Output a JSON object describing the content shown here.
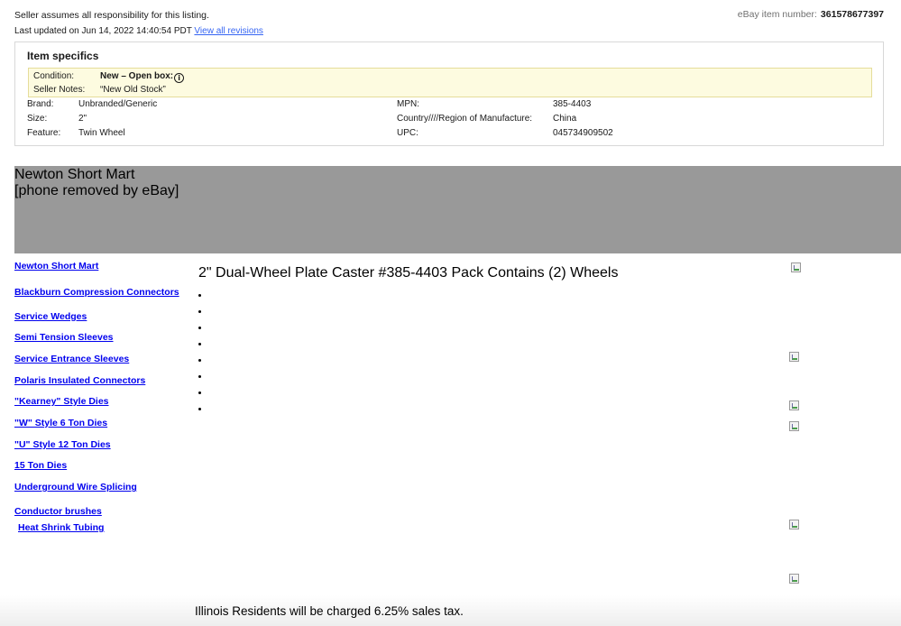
{
  "header": {
    "seller_note": "Seller assumes all responsibility for this listing.",
    "item_number_label": "eBay item number:",
    "item_number": "361578677397",
    "last_updated": "Last updated on Jun 14, 2022 14:40:54 PDT",
    "view_revisions": "View all revisions"
  },
  "specifics": {
    "title": "Item specifics",
    "condition_label": "Condition:",
    "condition_value": "New – Open box:",
    "seller_notes_label": "Seller Notes:",
    "seller_notes_value": "“New Old Stock”",
    "left": [
      {
        "label": "Brand:",
        "value": "Unbranded/Generic"
      },
      {
        "label": "Size:",
        "value": "2\""
      },
      {
        "label": "Feature:",
        "value": "Twin Wheel"
      }
    ],
    "right": [
      {
        "label": "MPN:",
        "value": "385-4403"
      },
      {
        "label": "Country////Region of Manufacture:",
        "value": "China"
      },
      {
        "label": "UPC:",
        "value": "045734909502"
      }
    ]
  },
  "banner": {
    "line1": "Newton Short Mart",
    "line2": "[phone removed by eBay]"
  },
  "nav": [
    "Newton Short Mart",
    "Blackburn Compression Connectors",
    "Service Wedges",
    "Semi Tension Sleeves",
    "Service Entrance Sleeves",
    "Polaris Insulated Connectors",
    "\"Kearney\" Style Dies",
    "\"W\" Style 6 Ton Dies",
    "\"U\" Style 12 Ton Dies",
    "15 Ton Dies",
    "Underground Wire Splicing",
    "Conductor brushes",
    "Heat Shrink Tubing"
  ],
  "product": {
    "title": "2\" Dual-Wheel Plate Caster #385-4403 Pack Contains (2) Wheels",
    "bullet_count": 8
  },
  "footer": {
    "tax_note": "Illinois Residents will be charged 6.25% sales tax."
  },
  "icons": {
    "info": "info-icon",
    "broken_image": "broken-image-icon"
  }
}
